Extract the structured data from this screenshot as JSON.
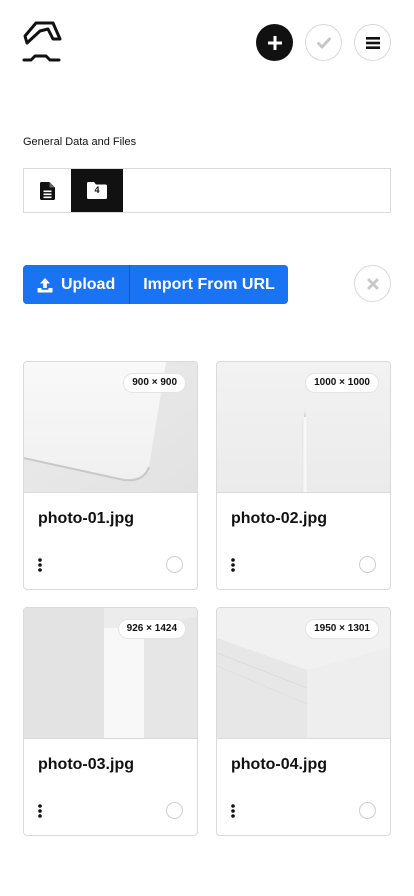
{
  "header": {
    "logo_icon": "brand-logo",
    "add_icon": "plus-icon",
    "confirm_icon": "check-icon",
    "menu_icon": "hamburger-menu-icon"
  },
  "section": {
    "title": "General Data and Files"
  },
  "tabs": {
    "document_icon": "document-icon",
    "files_icon": "folder-icon",
    "files_count": "4"
  },
  "actions": {
    "upload_label": "Upload",
    "upload_icon": "upload-icon",
    "import_url_label": "Import From URL",
    "clear_icon": "close-icon"
  },
  "files": [
    {
      "name": "photo-01.jpg",
      "dimensions": "900 × 900"
    },
    {
      "name": "photo-02.jpg",
      "dimensions": "1000 × 1000"
    },
    {
      "name": "photo-03.jpg",
      "dimensions": "926 × 1424"
    },
    {
      "name": "photo-04.jpg",
      "dimensions": "1950 × 1301"
    }
  ]
}
